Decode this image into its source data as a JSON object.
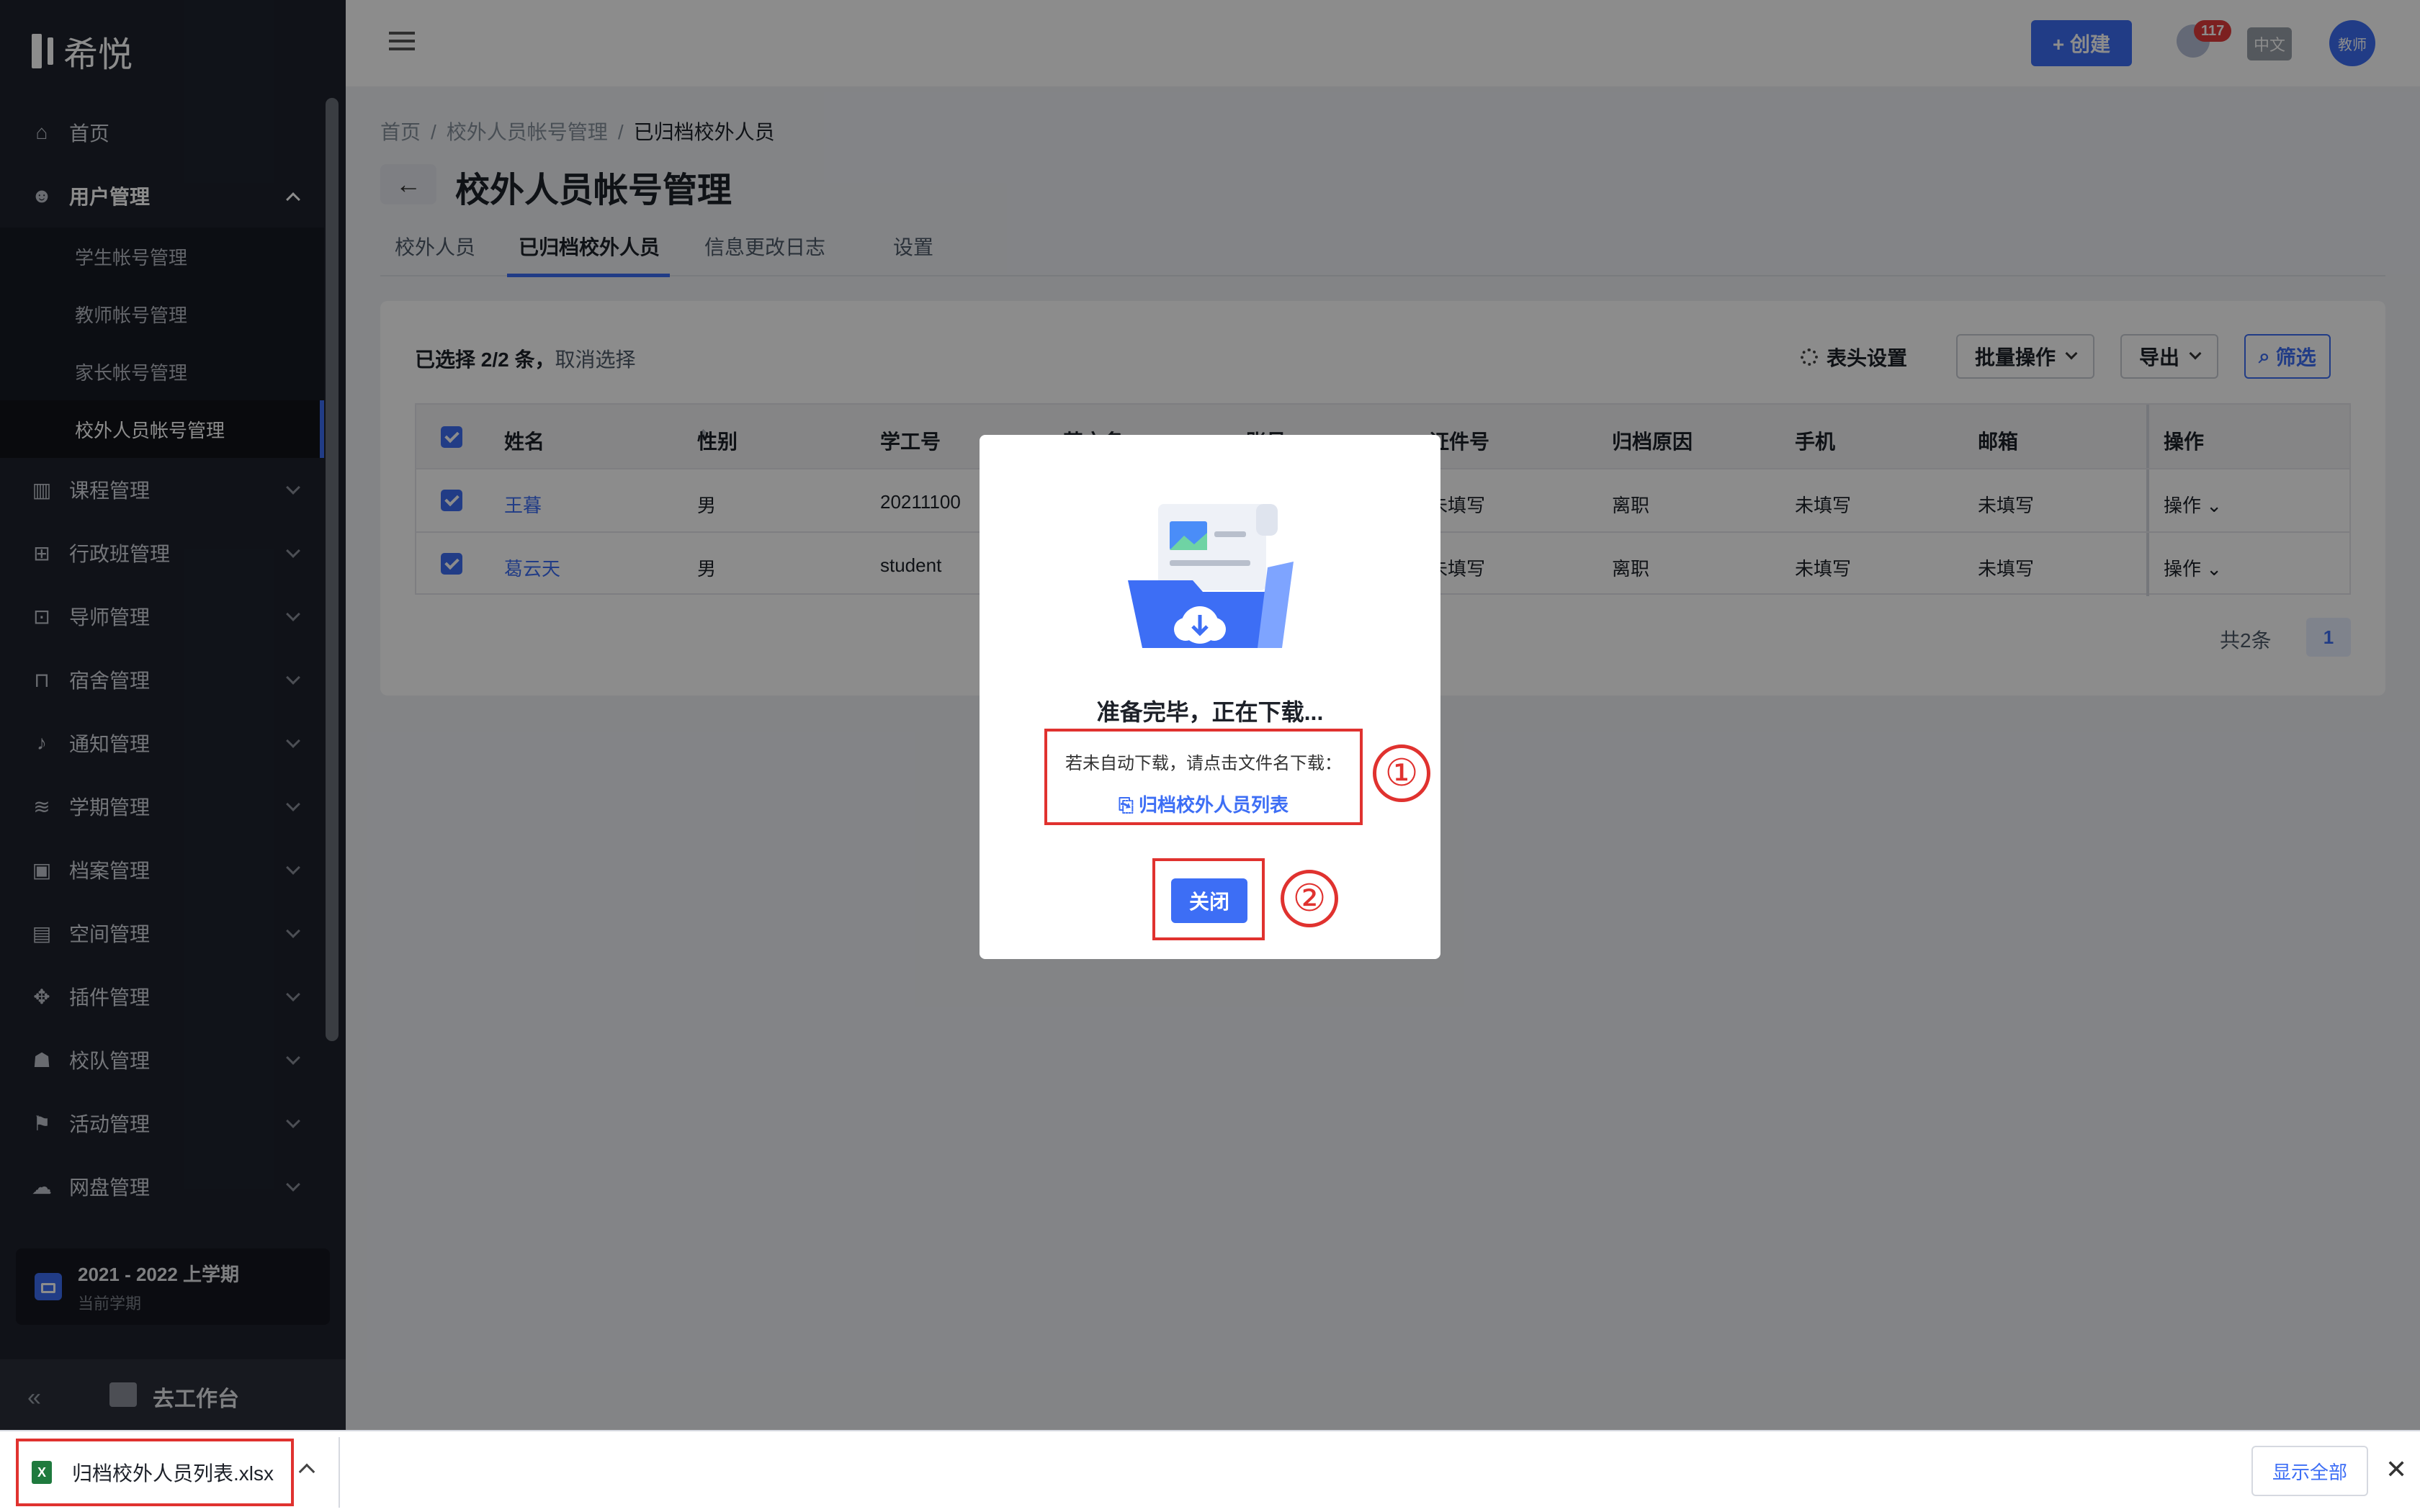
{
  "app": {
    "logo_text": "希悦"
  },
  "sidebar": {
    "items": [
      {
        "label": "首页",
        "icon": "home-icon",
        "glyph": "⌂"
      },
      {
        "label": "用户管理",
        "icon": "users-icon",
        "glyph": "☻",
        "open": true
      },
      {
        "label": "课程管理",
        "icon": "book-icon",
        "glyph": "▥"
      },
      {
        "label": "行政班管理",
        "icon": "class-icon",
        "glyph": "⊞"
      },
      {
        "label": "导师管理",
        "icon": "mentor-icon",
        "glyph": "⊡"
      },
      {
        "label": "宿舍管理",
        "icon": "bed-icon",
        "glyph": "⊓"
      },
      {
        "label": "通知管理",
        "icon": "bell-icon",
        "glyph": "♪"
      },
      {
        "label": "学期管理",
        "icon": "layers-icon",
        "glyph": "≋"
      },
      {
        "label": "档案管理",
        "icon": "archive-icon",
        "glyph": "▣"
      },
      {
        "label": "空间管理",
        "icon": "building-icon",
        "glyph": "▤"
      },
      {
        "label": "插件管理",
        "icon": "puzzle-icon",
        "glyph": "✥"
      },
      {
        "label": "校队管理",
        "icon": "team-icon",
        "glyph": "☗"
      },
      {
        "label": "活动管理",
        "icon": "flag-icon",
        "glyph": "⚑"
      },
      {
        "label": "网盘管理",
        "icon": "cloud-icon",
        "glyph": "☁"
      }
    ],
    "sub_items": [
      {
        "label": "学生帐号管理"
      },
      {
        "label": "教师帐号管理"
      },
      {
        "label": "家长帐号管理"
      },
      {
        "label": "校外人员帐号管理",
        "active": true
      }
    ],
    "term": {
      "title": "2021 - 2022 上学期",
      "subtitle": "当前学期"
    },
    "go_workbench": "去工作台"
  },
  "topbar": {
    "create_label": "+ 创建",
    "notification_count": "117",
    "lang": "中文",
    "avatar": "教师"
  },
  "breadcrumb": [
    "首页",
    "校外人员帐号管理",
    "已归档校外人员"
  ],
  "page": {
    "title": "校外人员帐号管理"
  },
  "tabs": [
    {
      "label": "校外人员"
    },
    {
      "label": "已归档校外人员",
      "active": true
    },
    {
      "label": "信息更改日志"
    },
    {
      "label": "设置"
    }
  ],
  "toolbar": {
    "selected_text": "已选择 2/2 条，",
    "cancel_select": "取消选择",
    "header_settings": "表头设置",
    "batch_ops": "批量操作",
    "export": "导出",
    "filter": "筛选"
  },
  "table": {
    "columns": [
      "姓名",
      "性别",
      "学工号",
      "英文名",
      "账号",
      "证件号",
      "归档原因",
      "手机",
      "邮箱",
      "操作"
    ],
    "rows": [
      {
        "name": "王暮",
        "gender": "男",
        "id": "20211100",
        "id_no": "未填写",
        "reason": "离职",
        "phone": "未填写",
        "email": "未填写",
        "op": "操作"
      },
      {
        "name": "葛云天",
        "gender": "男",
        "id": "student",
        "id_no": "未填写",
        "reason": "离职",
        "phone": "未填写",
        "email": "未填写",
        "op": "操作"
      }
    ],
    "total": "共2条",
    "page": "1"
  },
  "dialog": {
    "title": "准备完毕，正在下载...",
    "hint": "若未自动下载，请点击文件名下载：",
    "file_link": "归档校外人员列表",
    "close_label": "关闭",
    "marker1": "①",
    "marker2": "②"
  },
  "download_bar": {
    "file_name": "归档校外人员列表.xlsx",
    "show_all": "显示全部"
  },
  "colors": {
    "accent": "#3d6ef5",
    "sidebar_bg": "#1e222d",
    "annotation_red": "#e0322f"
  }
}
